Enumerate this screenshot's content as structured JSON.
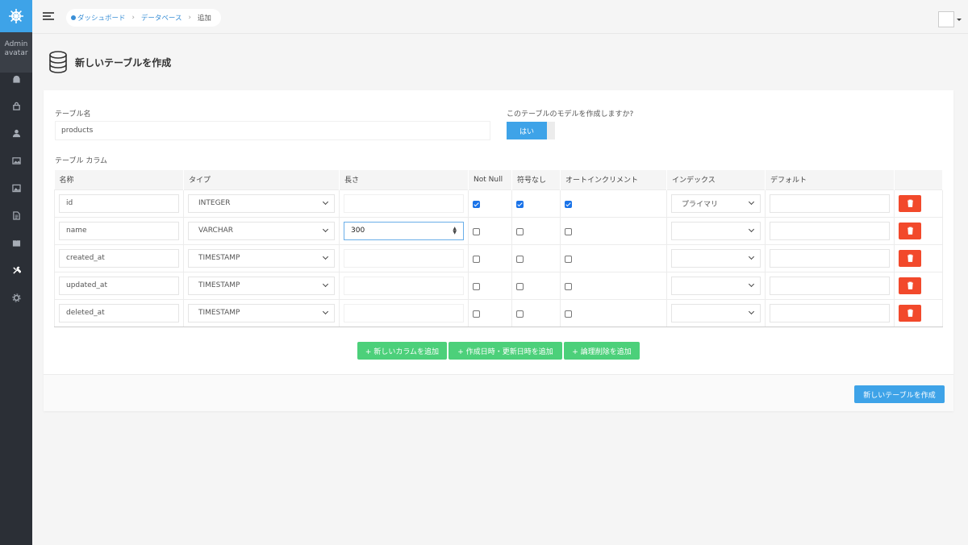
{
  "sidebar": {
    "avatar_alt": "Admin avatar",
    "items": [
      {
        "icon": "android-icon"
      },
      {
        "icon": "lock-icon"
      },
      {
        "icon": "user-icon"
      },
      {
        "icon": "images-icon"
      },
      {
        "icon": "image-icon"
      },
      {
        "icon": "document-icon"
      },
      {
        "icon": "book-icon"
      },
      {
        "icon": "tools-icon"
      },
      {
        "icon": "gear-icon"
      }
    ]
  },
  "breadcrumb": {
    "items": [
      {
        "label": "ダッシュボード"
      },
      {
        "label": "データベース"
      },
      {
        "label": "追加"
      }
    ]
  },
  "page": {
    "title": "新しいテーブルを作成"
  },
  "form": {
    "table_name_label": "テーブル名",
    "table_name_value": "products",
    "model_question": "このテーブルのモデルを作成しますか?",
    "model_toggle_label": "はい",
    "columns_label": "テーブル カラム"
  },
  "table": {
    "headers": [
      "名称",
      "タイプ",
      "長さ",
      "Not Null",
      "符号なし",
      "オートインクリメント",
      "インデックス",
      "デフォルト",
      ""
    ],
    "rows": [
      {
        "name": "id",
        "type": "INTEGER",
        "length": "",
        "not_null": true,
        "unsigned": true,
        "auto_increment": true,
        "index": "プライマリ",
        "default": ""
      },
      {
        "name": "name",
        "type": "VARCHAR",
        "length": "300",
        "not_null": false,
        "unsigned": false,
        "auto_increment": false,
        "index": "",
        "default": ""
      },
      {
        "name": "created_at",
        "type": "TIMESTAMP",
        "length": "",
        "not_null": false,
        "unsigned": false,
        "auto_increment": false,
        "index": "",
        "default": ""
      },
      {
        "name": "updated_at",
        "type": "TIMESTAMP",
        "length": "",
        "not_null": false,
        "unsigned": false,
        "auto_increment": false,
        "index": "",
        "default": ""
      },
      {
        "name": "deleted_at",
        "type": "TIMESTAMP",
        "length": "",
        "not_null": false,
        "unsigned": false,
        "auto_increment": false,
        "index": "",
        "default": ""
      }
    ]
  },
  "actions": {
    "add_column": "+ 新しいカラムを追加",
    "add_timestamps": "+ 作成日時・更新日時を追加",
    "add_soft_delete": "+ 論理削除を追加",
    "submit": "新しいテーブルを作成"
  },
  "colors": {
    "accent": "#3ea3e8",
    "success": "#4cd07a",
    "danger": "#f2492b",
    "sidebar": "#2b2f36"
  }
}
